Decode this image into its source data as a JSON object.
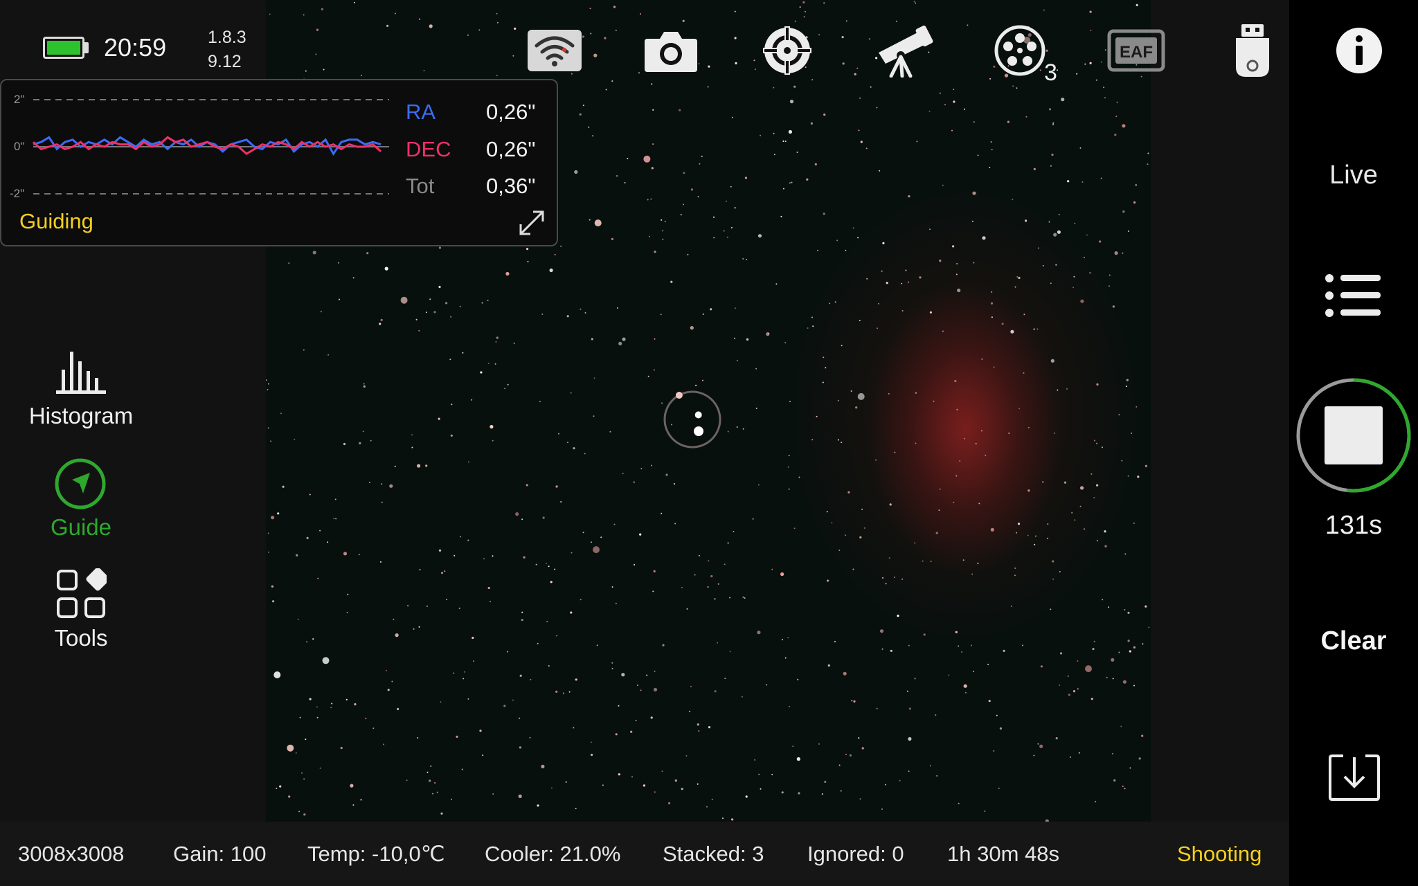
{
  "status": {
    "battery_icon": "battery-icon",
    "battery_color": "#2ec12e",
    "time": "20:59",
    "version_app": "1.8.3",
    "version_fw": "9.12"
  },
  "toolbar": {
    "items": [
      {
        "name": "wifi-icon",
        "interactable": true
      },
      {
        "name": "camera-icon",
        "interactable": true
      },
      {
        "name": "guide-scope-icon",
        "interactable": true
      },
      {
        "name": "telescope-icon",
        "interactable": true
      },
      {
        "name": "filter-wheel-icon",
        "interactable": true
      },
      {
        "name": "eaf-icon",
        "interactable": true
      },
      {
        "name": "usb-drive-icon",
        "interactable": true
      },
      {
        "name": "info-icon",
        "interactable": true
      }
    ],
    "eaf_label": "EAF",
    "filter_wheel_count": "3"
  },
  "guiding": {
    "title": "Guiding",
    "axis_top": "2\"",
    "axis_mid": "0\"",
    "axis_bottom": "-2\"",
    "ra_label": "RA",
    "ra_value": "0,26\"",
    "dec_label": "DEC",
    "dec_value": "0,26\"",
    "tot_label": "Tot",
    "tot_value": "0,36\"",
    "ra_color": "#3b6cf5",
    "dec_color": "#f0306a",
    "ra_series": [
      0.1,
      0.2,
      0.4,
      -0.1,
      0.2,
      0.3,
      0.0,
      0.2,
      0.1,
      0.3,
      0.1,
      0.4,
      0.2,
      0.0,
      0.3,
      0.1,
      0.2,
      -0.1,
      0.2,
      0.1,
      0.3,
      0.0,
      0.2,
      0.1,
      -0.2,
      0.1,
      0.2,
      0.3,
      0.0,
      -0.1,
      0.2,
      0.1,
      0.3,
      -0.2,
      0.1,
      0.2,
      0.0,
      0.3,
      -0.3,
      0.2,
      0.3,
      0.3,
      0.1,
      0.2,
      0.1
    ],
    "dec_series": [
      0.2,
      -0.1,
      0.0,
      0.1,
      -0.1,
      0.0,
      0.2,
      -0.1,
      0.1,
      0.0,
      0.2,
      0.1,
      0.1,
      -0.1,
      0.2,
      0.0,
      0.1,
      0.4,
      0.2,
      0.3,
      0.0,
      0.1,
      0.2,
      0.0,
      -0.1,
      0.1,
      0.0,
      -0.3,
      -0.1,
      0.1,
      0.0,
      0.2,
      0.1,
      -0.1,
      0.2,
      0.0,
      0.2,
      0.0,
      0.1,
      -0.1,
      0.1,
      0.0,
      0.0,
      0.1,
      -0.2
    ]
  },
  "nav": {
    "histogram": "Histogram",
    "guide": "Guide",
    "tools": "Tools",
    "guide_color": "#2ea82e"
  },
  "right": {
    "live": "Live",
    "seconds": "131s",
    "progress": 0.52,
    "clear": "Clear"
  },
  "bottom": {
    "resolution": "3008x3008",
    "gain": "Gain: 100",
    "temp": "Temp: -10,0℃",
    "cooler": "Cooler: 21.0%",
    "stacked": "Stacked: 3",
    "ignored": "Ignored: 0",
    "duration": "1h 30m 48s",
    "state": "Shooting"
  }
}
